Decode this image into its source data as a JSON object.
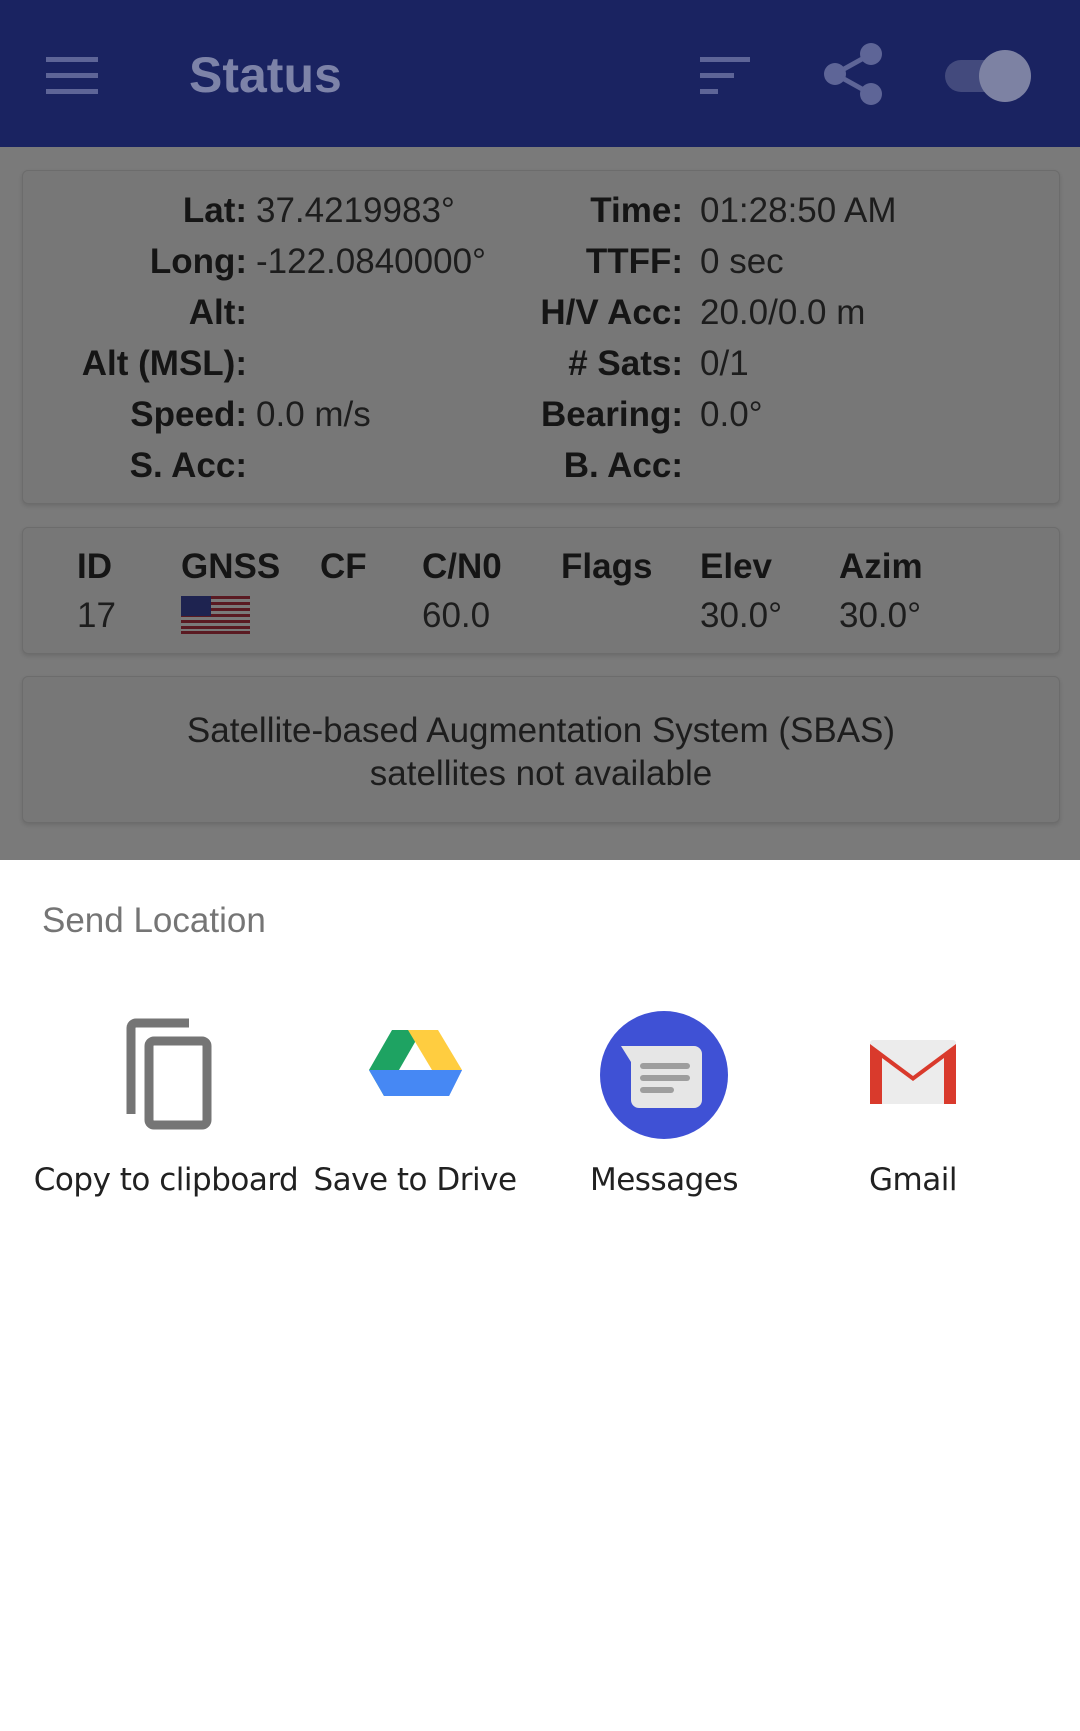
{
  "appbar": {
    "title": "Status",
    "icons": [
      "menu-icon",
      "sort-icon",
      "share-icon"
    ],
    "toggle_on": true,
    "color": "#1a2361"
  },
  "location": {
    "rows": [
      {
        "label": "Lat:",
        "value": "37.4219983°",
        "label2": "Time:",
        "value2": "01:28:50 AM"
      },
      {
        "label": "Long:",
        "value": "-122.0840000°",
        "label2": "TTFF:",
        "value2": "0 sec"
      },
      {
        "label": "Alt:",
        "value": "",
        "label2": "H/V Acc:",
        "value2": "20.0/0.0 m"
      },
      {
        "label": "Alt (MSL):",
        "value": "",
        "label2": "# Sats:",
        "value2": "0/1"
      },
      {
        "label": "Speed:",
        "value": "0.0 m/s",
        "label2": "Bearing:",
        "value2": "0.0°"
      },
      {
        "label": "S. Acc:",
        "value": "",
        "label2": "B. Acc:",
        "value2": ""
      }
    ]
  },
  "satellites": {
    "headers": [
      "ID",
      "GNSS",
      "CF",
      "C/N0",
      "Flags",
      "Elev",
      "Azim"
    ],
    "rows": [
      {
        "id": "17",
        "gnss": "us-flag-icon",
        "cf": "",
        "cn0": "60.0",
        "flags": "",
        "elev": "30.0°",
        "azim": "30.0°"
      }
    ]
  },
  "sbas": {
    "line1": "Satellite-based Augmentation System (SBAS)",
    "line2": "satellites not available"
  },
  "sheet": {
    "title": "Send Location",
    "targets": [
      {
        "label": "Copy to clipboard",
        "icon": "copy-icon"
      },
      {
        "label": "Save to Drive",
        "icon": "google-drive-icon"
      },
      {
        "label": "Messages",
        "icon": "messages-icon"
      },
      {
        "label": "Gmail",
        "icon": "gmail-icon"
      }
    ]
  }
}
